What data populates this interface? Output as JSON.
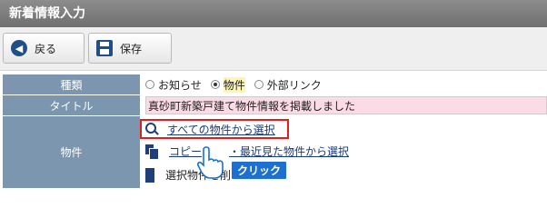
{
  "header": {
    "title": "新着情報入力"
  },
  "toolbar": {
    "back_label": "戻る",
    "save_label": "保存"
  },
  "form": {
    "type_label": "種類",
    "type_options": [
      "お知らせ",
      "物件",
      "外部リンク"
    ],
    "type_selected": "物件",
    "title_label": "タイトル",
    "title_value": "真砂町新築戸建て物件情報を掲載しました",
    "property_label": "物件",
    "actions": {
      "select_all": "すべての物件から選択",
      "copy_prefix": "コピー",
      "copy_suffix": "・最近見た物件から選択",
      "delete_selected": "選択物件を削除"
    }
  },
  "annotation": {
    "click_badge": "クリック"
  }
}
